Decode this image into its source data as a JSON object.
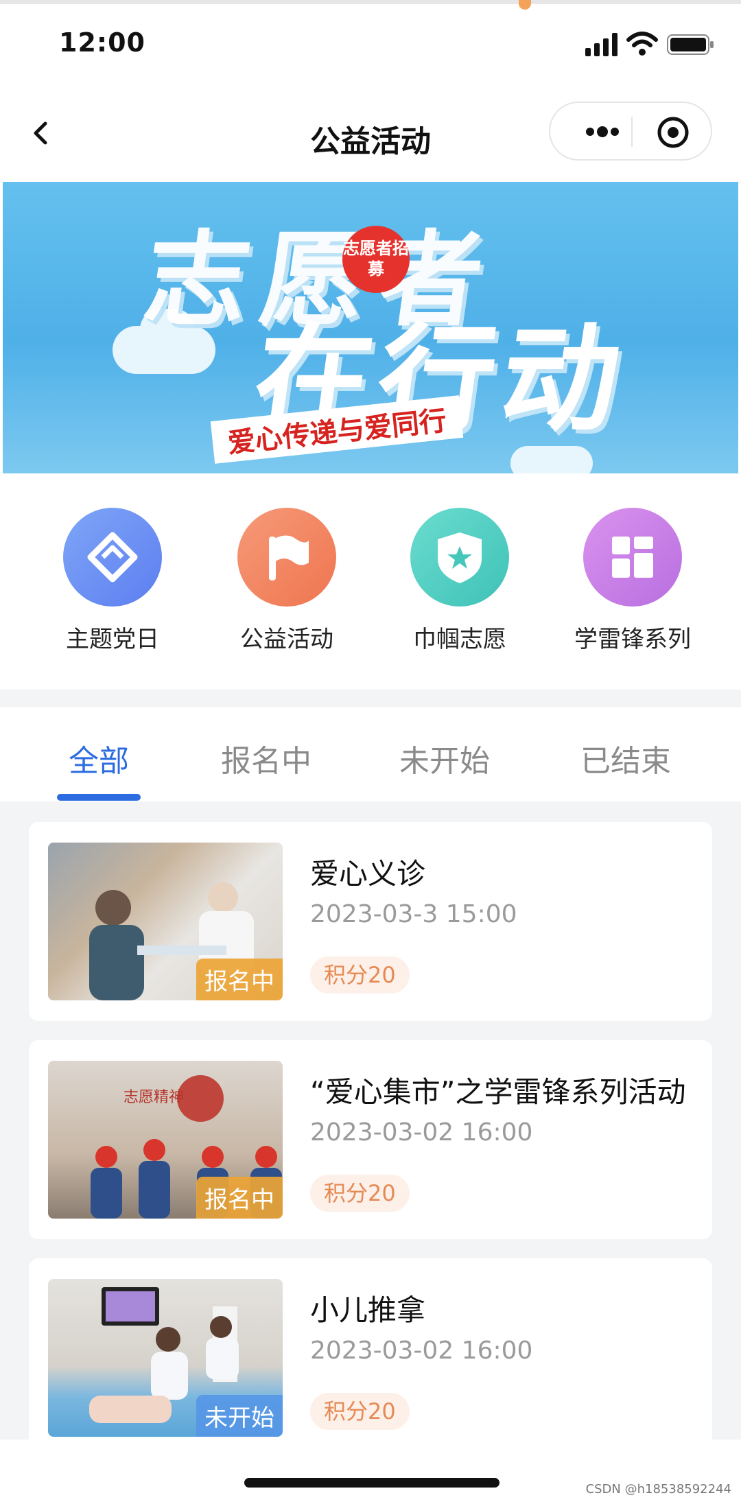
{
  "status_bar": {
    "time": "12:00"
  },
  "nav": {
    "title": "公益活动"
  },
  "banner": {
    "headline_line1": "志愿者",
    "headline_line2": "在行动",
    "badge": "志愿者招募",
    "slogan": "爱心传递与爱同行"
  },
  "categories": [
    {
      "label": "主题党日",
      "icon": "handshake-icon",
      "color": "#6b8ff2"
    },
    {
      "label": "公益活动",
      "icon": "flag-icon",
      "color": "#f2845f"
    },
    {
      "label": "巾帼志愿",
      "icon": "shield-star-icon",
      "color": "#4ccfc3"
    },
    {
      "label": "学雷锋系列",
      "icon": "grid-icon",
      "color": "#c77ce6"
    }
  ],
  "tabs": [
    {
      "label": "全部",
      "active": true
    },
    {
      "label": "报名中",
      "active": false
    },
    {
      "label": "未开始",
      "active": false
    },
    {
      "label": "已结束",
      "active": false
    }
  ],
  "activities": [
    {
      "title": "爱心义诊",
      "time": "2023-03-3  15:00",
      "points": "积分20",
      "status": "报名中"
    },
    {
      "title": "“爱心集市”之学雷锋系列活动",
      "time": "2023-03-02  16:00",
      "points": "积分20",
      "status": "报名中"
    },
    {
      "title": "小儿推拿",
      "time": "2023-03-02  16:00",
      "points": "积分20",
      "status": "未开始"
    }
  ],
  "watermark": "CSDN @h18538592244",
  "colors": {
    "accent": "#2c6ce0",
    "points_text": "#e58a55",
    "badge_orange": "#eca436"
  }
}
